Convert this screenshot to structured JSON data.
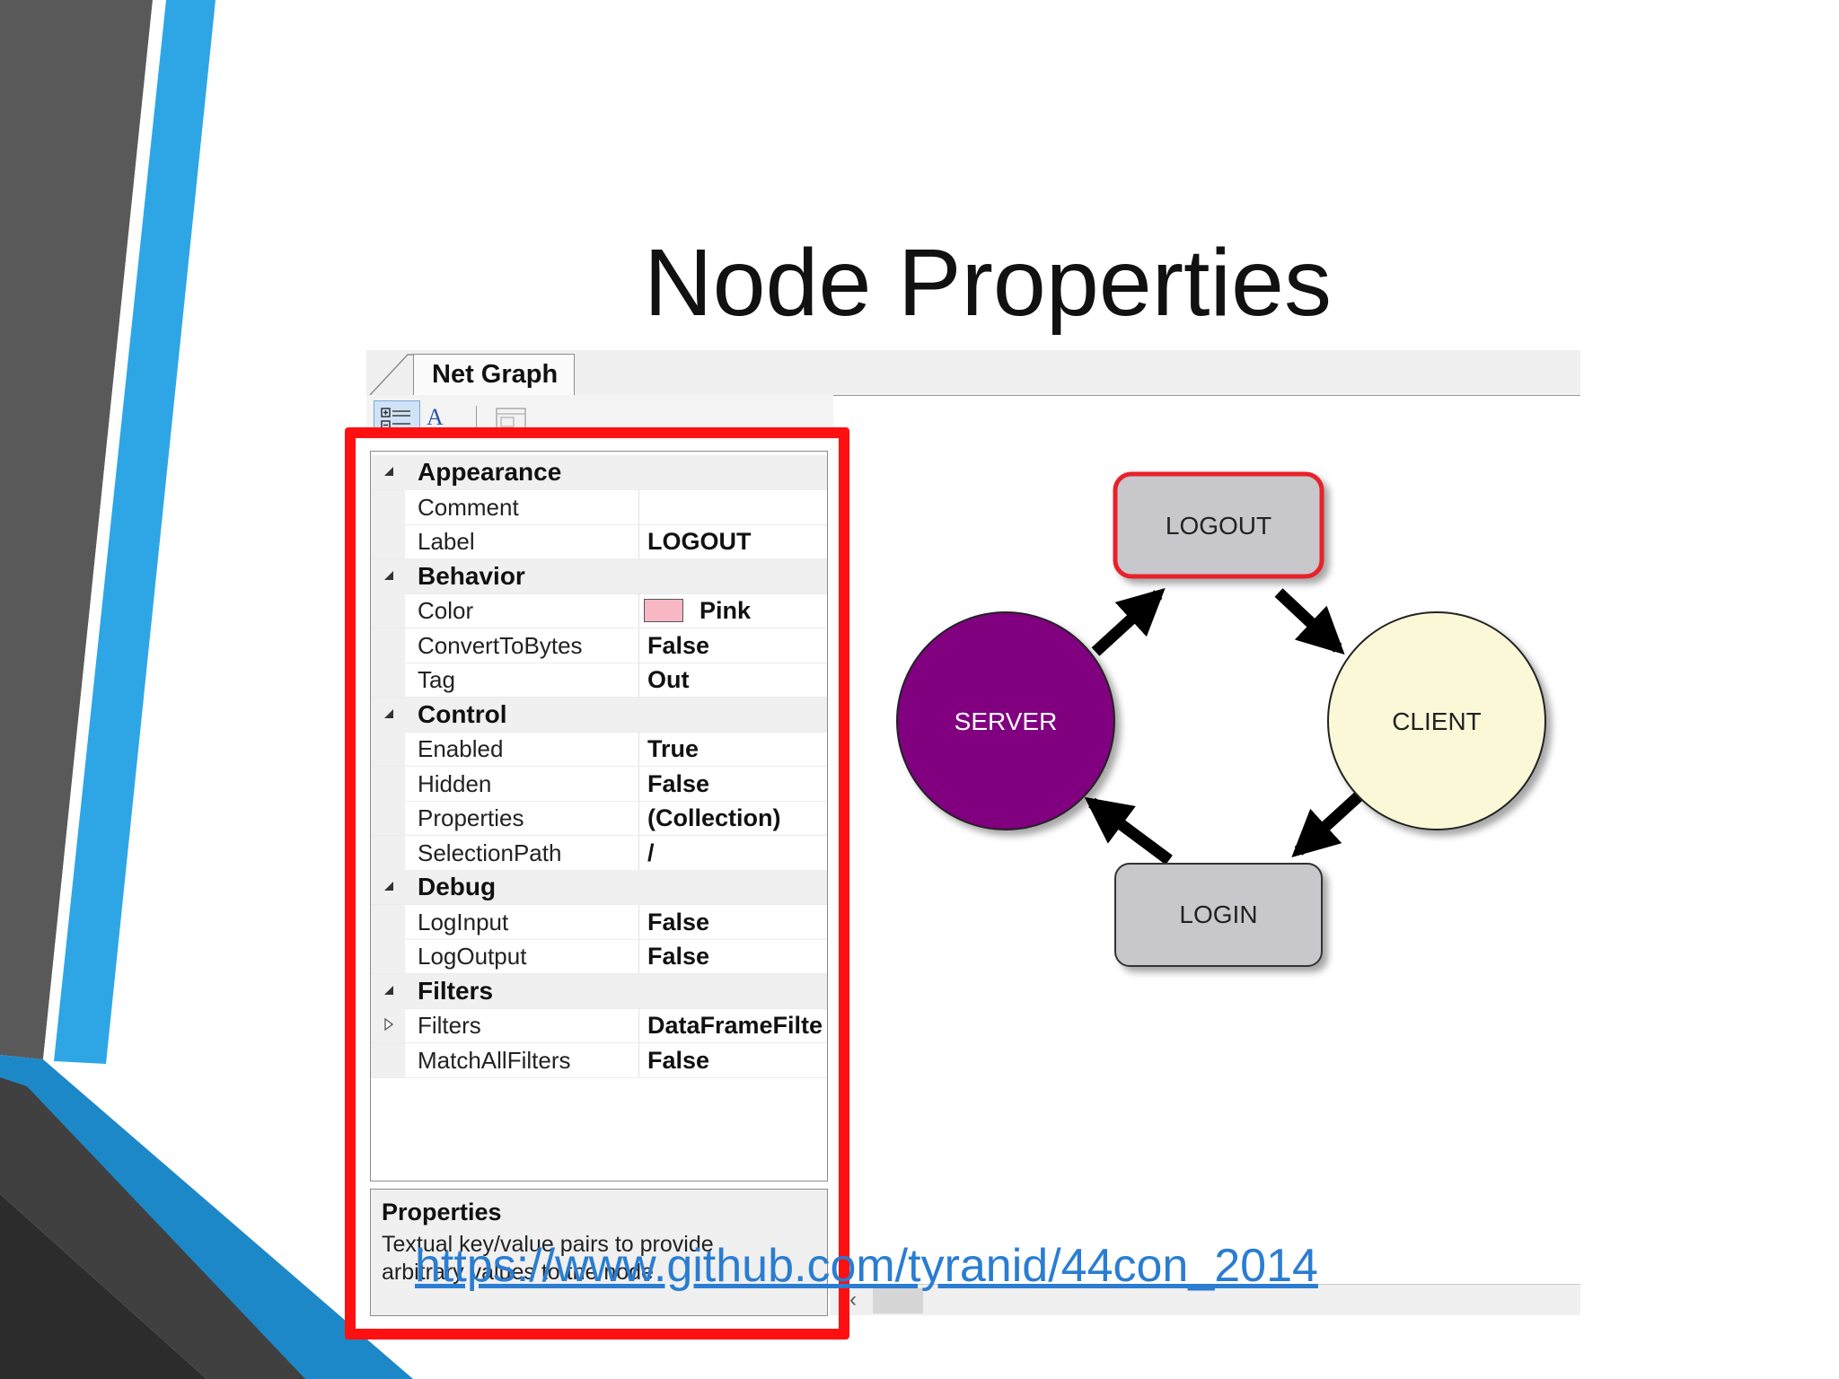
{
  "slide": {
    "title": "Node Properties",
    "link_text": "https://www.github.com/tyranid/44con_2014"
  },
  "window": {
    "tab_label": "Net Graph",
    "toolbar": {
      "alphabetical_glyph": "A"
    }
  },
  "property_grid": {
    "rows": [
      {
        "kind": "category",
        "name": "Appearance"
      },
      {
        "kind": "property",
        "name": "Comment",
        "value": ""
      },
      {
        "kind": "property",
        "name": "Label",
        "value": "LOGOUT"
      },
      {
        "kind": "category",
        "name": "Behavior"
      },
      {
        "kind": "property",
        "name": "Color",
        "value": "Pink",
        "swatch": "#f7b8c4"
      },
      {
        "kind": "property",
        "name": "ConvertToBytes",
        "value": "False"
      },
      {
        "kind": "property",
        "name": "Tag",
        "value": "Out"
      },
      {
        "kind": "category",
        "name": "Control"
      },
      {
        "kind": "property",
        "name": "Enabled",
        "value": "True"
      },
      {
        "kind": "property",
        "name": "Hidden",
        "value": "False"
      },
      {
        "kind": "property",
        "name": "Properties",
        "value": "(Collection)"
      },
      {
        "kind": "property",
        "name": "SelectionPath",
        "value": "/"
      },
      {
        "kind": "category",
        "name": "Debug"
      },
      {
        "kind": "property",
        "name": "LogInput",
        "value": "False"
      },
      {
        "kind": "property",
        "name": "LogOutput",
        "value": "False"
      },
      {
        "kind": "category",
        "name": "Filters"
      },
      {
        "kind": "property",
        "name": "Filters",
        "value": "DataFrameFilte",
        "expandable": true
      },
      {
        "kind": "property",
        "name": "MatchAllFilters",
        "value": "False"
      }
    ]
  },
  "help_panel": {
    "title": "Properties",
    "text": "Textual key/value pairs to provide arbitrary values to the node"
  },
  "diagram": {
    "nodes": {
      "logout": {
        "label": "LOGOUT",
        "fill": "#c8c7cb",
        "selected": true
      },
      "server": {
        "label": "SERVER",
        "fill": "#800080"
      },
      "client": {
        "label": "CLIENT",
        "fill": "#fbf8d8"
      },
      "login": {
        "label": "LOGIN",
        "fill": "#c8c7cb"
      }
    },
    "edges": [
      {
        "from": "SERVER",
        "to": "LOGOUT"
      },
      {
        "from": "LOGOUT",
        "to": "CLIENT"
      },
      {
        "from": "CLIENT",
        "to": "LOGIN"
      },
      {
        "from": "LOGIN",
        "to": "SERVER"
      }
    ]
  },
  "colors": {
    "highlight_border": "#ff1010",
    "accent_blue": "#2ea6e6",
    "dark_gray": "#404040",
    "selection_border": "#e8202a"
  }
}
